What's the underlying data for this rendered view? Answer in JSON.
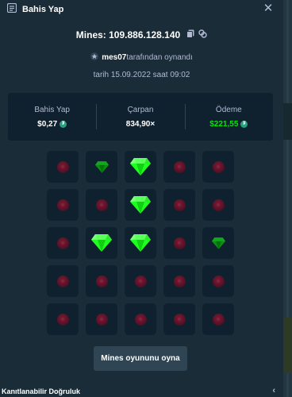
{
  "header": {
    "title": "Bahis Yap",
    "icon": "bet-slip-icon",
    "close_icon": "close-icon"
  },
  "mines": {
    "label": "Mines: 109.886.128.140",
    "copy_icon": "copy-icon",
    "link_icon": "link-icon"
  },
  "played": {
    "user": "mes07",
    "suffix": "tarafından oynandı",
    "star_icon": "star-icon"
  },
  "date": {
    "text": "tarih 15.09.2022 saat 09:02"
  },
  "stats": {
    "bet": {
      "label": "Bahis Yap",
      "value": "$0,27",
      "currency_icon": "tether-icon"
    },
    "multiplier": {
      "label": "Çarpan",
      "value": "834,90×"
    },
    "payout": {
      "label": "Ödeme",
      "value": "$221,55",
      "currency_icon": "tether-icon"
    }
  },
  "grid": {
    "rows": [
      [
        "mine",
        "gem-small",
        "gem",
        "mine",
        "mine"
      ],
      [
        "mine",
        "mine",
        "gem",
        "mine",
        "mine"
      ],
      [
        "mine",
        "gem",
        "gem",
        "mine",
        "gem-small"
      ],
      [
        "mine",
        "mine",
        "mine",
        "mine",
        "mine"
      ],
      [
        "mine",
        "mine",
        "mine",
        "mine",
        "mine"
      ]
    ]
  },
  "play_button": {
    "label": "Mines oyununu oyna"
  },
  "footer": {
    "label": "Kanıtlanabilir Doğruluk"
  },
  "colors": {
    "background": "#1a2c38",
    "panel": "#0f212e",
    "accent_green": "#00e701",
    "muted": "#b1bad3"
  }
}
